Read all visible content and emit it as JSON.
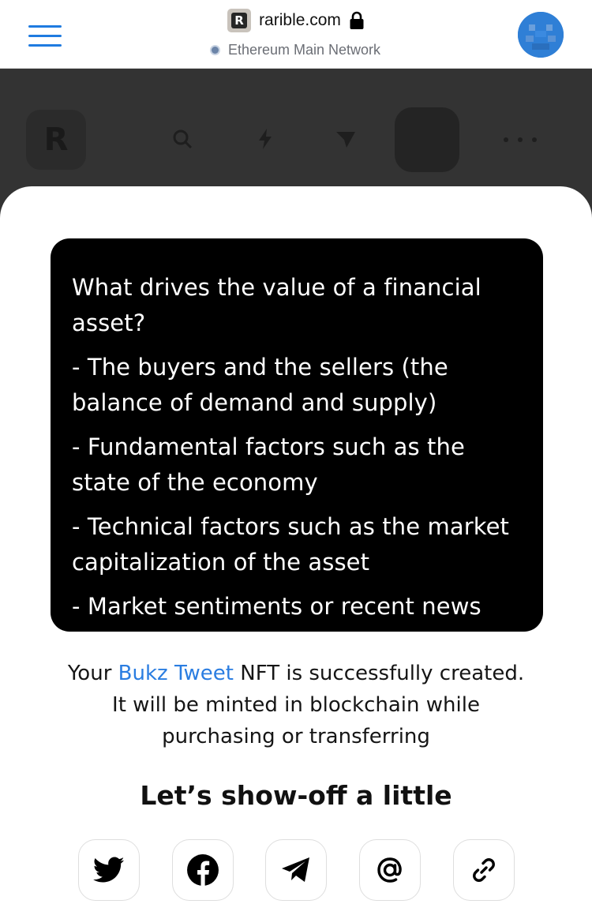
{
  "browser": {
    "site_badge_letter": "R",
    "url": "rarible.com",
    "network": "Ethereum Main Network"
  },
  "background": {
    "logo_letter": "R"
  },
  "tweet": {
    "lines": [
      "What drives the value of a financial asset?",
      "- The buyers and the sellers (the balance of demand and supply)",
      "- Fundamental factors such as the state of the economy",
      "- Technical factors such as the market capitalization of the asset",
      "- Market sentiments or recent news"
    ]
  },
  "success": {
    "prefix": "Your ",
    "nft_name": "Bukz Tweet",
    "line1_suffix": " NFT is successfully created.",
    "line2": "It will be minted in blockchain while",
    "line3": "purchasing or transferring"
  },
  "share": {
    "heading": "Let’s show-off a little",
    "buttons": [
      "twitter-icon",
      "facebook-icon",
      "telegram-icon",
      "email-icon",
      "link-icon"
    ]
  },
  "colors": {
    "accent": "#1f7be0",
    "link": "#2a7de1",
    "overlay": "#333333"
  }
}
